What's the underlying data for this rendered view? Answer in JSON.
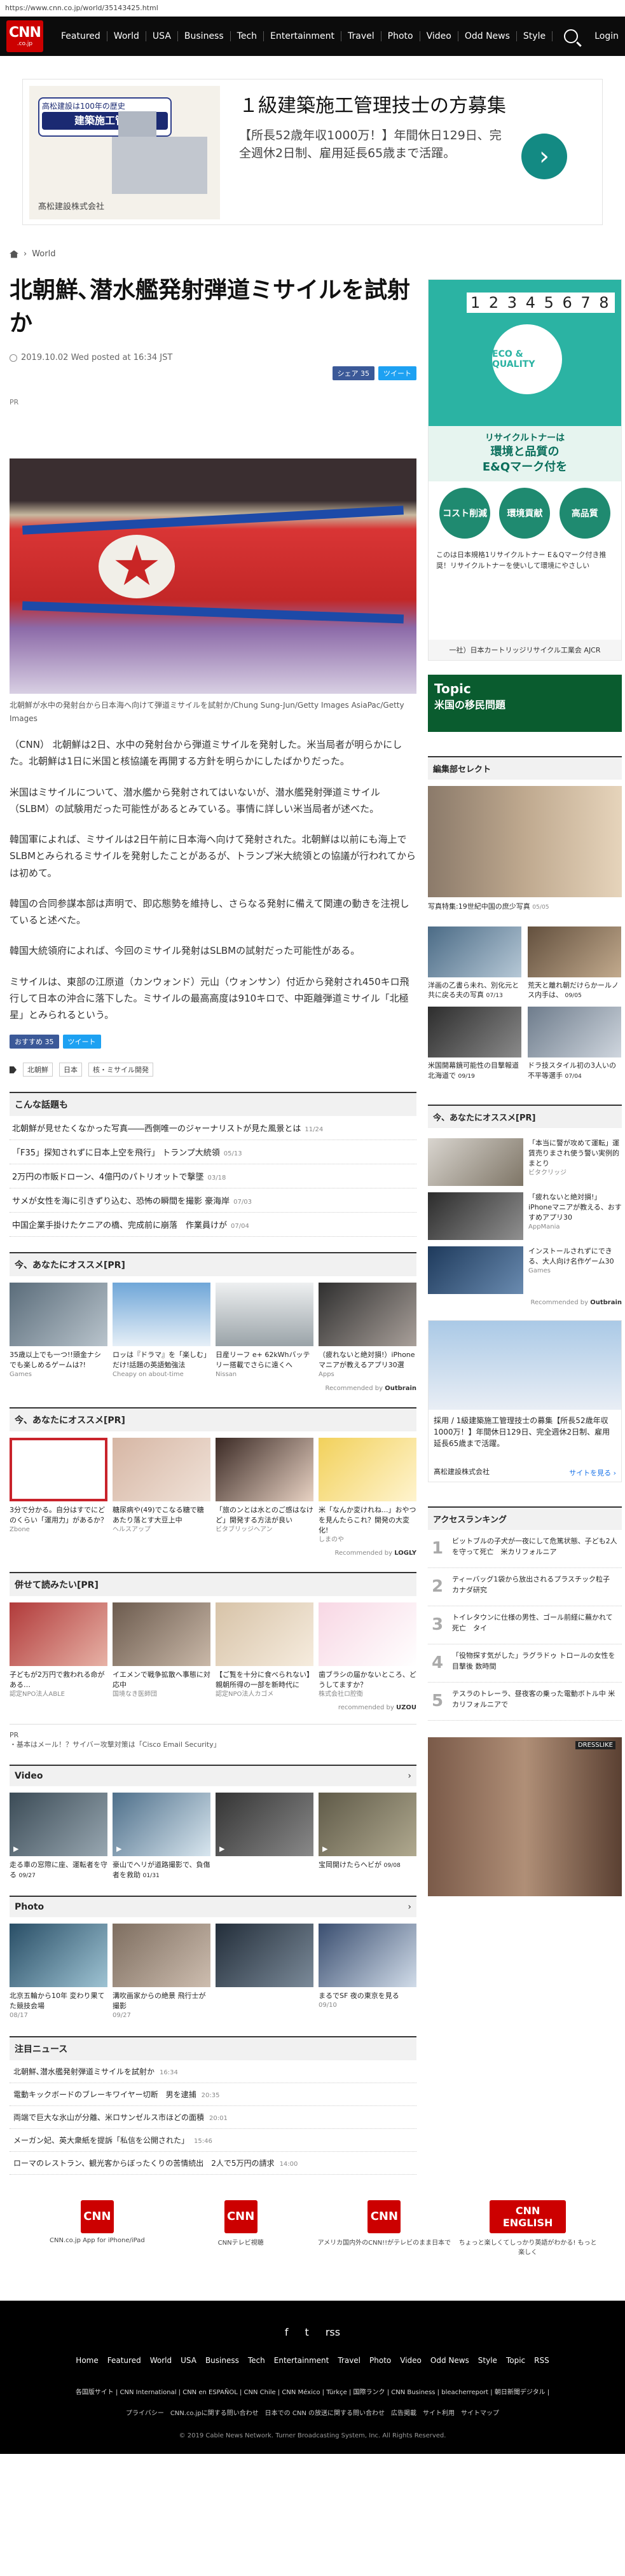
{
  "browser": {
    "url": "https://www.cnn.co.jp/world/35143425.html"
  },
  "nav": {
    "logo": "CNN",
    "logo_sub": ".co.jp",
    "links": [
      "Featured",
      "World",
      "USA",
      "Business",
      "Tech",
      "Entertainment",
      "Travel",
      "Photo",
      "Video",
      "Odd News",
      "Style"
    ],
    "login": "Login"
  },
  "ad_top": {
    "banner_line1": "高松建設は100年の歴史",
    "banner_title": "建築施工管理",
    "banner_company": "髙松建設株式会社",
    "headline": "１級建築施工管理技士の方募集",
    "body": "【所長52歳年収1000万！】年間休日129日、完全週休2日制、雇用延長65歳まで活躍。",
    "arrow": "›"
  },
  "breadcrumb": {
    "section": "World"
  },
  "article": {
    "title": "北朝鮮､潜水艦発射弾道ミサイルを試射か",
    "date": "2019.10.02 Wed posted at 16:34 JST",
    "share_fb": "シェア 35",
    "share_tw": "ツイート",
    "pr": "PR",
    "caption": "北朝鮮が水中の発射台から日本海へ向けて弾道ミサイルを試射か/Chung Sung-Jun/Getty Images AsiaPac/Getty Images",
    "paragraphs": [
      "（CNN） 北朝鮮は2日、水中の発射台から弾道ミサイルを発射した。米当局者が明らかにした。北朝鮮は1日に米国と核協議を再開する方針を明らかにしたばかりだった。",
      "米国はミサイルについて、潜水艦から発射されてはいないが、潜水艦発射弾道ミサイル（SLBM）の試験用だった可能性があるとみている。事情に詳しい米当局者が述べた。",
      "韓国軍によれば、ミサイルは2日午前に日本海へ向けて発射された。北朝鮮は以前にも海上でSLBMとみられるミサイルを発射したことがあるが、トランプ米大統領との協議が行われてからは初めて。",
      "韓国の合同参謀本部は声明で、即応態勢を維持し、さらなる発射に備えて関連の動きを注視していると述べた。",
      "韓国大統領府によれば、今回のミサイル発射はSLBMの試射だった可能性がある。",
      "ミサイルは、東部の江原道（カンウォンド）元山（ウォンサン）付近から発射され450キロ飛行して日本の沖合に落下した。ミサイルの最高高度は910キロで、中距離弾道ミサイル「北極星」とみられるという。"
    ],
    "share2_fb": "おすすめ 35",
    "share2_tw": "ツイート",
    "tags": [
      "北朝鮮",
      "日本",
      "核・ミサイル開発"
    ]
  },
  "related": {
    "heading": "こんな話題も",
    "items": [
      {
        "text": "北朝鮮が見せたくなかった写真――西側唯一のジャーナリストが見た風景とは",
        "date": "11/24"
      },
      {
        "text": "「F35」探知されずに日本上空を飛行」 トランプ大統領",
        "date": "05/13"
      },
      {
        "text": "2万円の市販ドローン、4億円のパトリオットで撃墜",
        "date": "03/18"
      },
      {
        "text": "サメが女性を海に引きずり込む、恐怖の瞬間を撮影 豪海岸",
        "date": "07/03"
      },
      {
        "text": "中国企業手掛けたケニアの橋、完成前に崩落　作業員けが",
        "date": "07/04"
      }
    ]
  },
  "recommend1": {
    "heading": "今、あなたにオススメ[PR]",
    "cards": [
      {
        "text": "35歳以上でも一つ!!頭金ナシでも楽しめるゲームは?!",
        "src": "Games"
      },
      {
        "text": "ロッは『ドラマ』を「楽しむ」だけ!話題の英語勉強法",
        "src": "Cheapy on about-time"
      },
      {
        "text": "日産リーフ e+ 62kWhバッテリー搭載でさらに遠くへ",
        "src": "Nissan"
      },
      {
        "text": "（疲れないと絶対損!）iPhoneマニアが教えるアプリ30選",
        "src": "Apps"
      }
    ],
    "footer": "Recommended by",
    "brand": "Outbrain"
  },
  "recommend2": {
    "heading": "今、あなたにオススメ[PR]",
    "cards": [
      {
        "text": "3分で分かる。自分はすでにどのくらい「運用力」があるか？",
        "src": "Zbone"
      },
      {
        "text": "糖尿病や(49)でこなる糖で糖あたり落とす大豆上中",
        "src": "ヘルスアップ"
      },
      {
        "text": "「旅のンとは水とのご感はなけど」開発する方法が良い",
        "src": "ビタブリッジヘアン"
      },
      {
        "text": "米「なんか変けれね...」おやつを見んたらこれ？開発の大変化!",
        "src": "しまのや"
      }
    ],
    "footer": "Recommended by",
    "brand": "LOGLY"
  },
  "recommend3": {
    "heading": "併せて読みたい[PR]",
    "cards": [
      {
        "text": "子どもが2万円で救われる命がある…",
        "src": "認定NPO法人ABLE"
      },
      {
        "text": "イエメンで戦争拡散へ事態に対応中",
        "src": "国境なき医師団"
      },
      {
        "text": "【ご覧を十分に食べられない】親朝所得の一部を新時代に",
        "src": "認定NPO法人カゴメ"
      },
      {
        "text": "歯ブラシの届かないところ、どうしてますか？",
        "src": "株式会社ロ腔衛"
      }
    ],
    "footer": "recommended by",
    "brand": "UZOU",
    "pr_line": "PR",
    "pr_text": "・基本はメール！？サイバー攻撃対策は「Cisco Email Security」"
  },
  "video": {
    "heading": "Video",
    "chevron": "›",
    "cards": [
      {
        "text": "走る車の窓際に座、運転者を守る",
        "date": "09/27"
      },
      {
        "text": "豪山でヘリが道路撮影で、負傷者を救助",
        "date": "01/31"
      },
      {
        "text": "",
        "date": ""
      },
      {
        "text": "宝岡開けたらヘビが",
        "date": "09/08"
      }
    ]
  },
  "photo": {
    "heading": "Photo",
    "chevron": "›",
    "cards": [
      {
        "text": "北京五輪から10年 変わり果てた競技会場",
        "date": "08/17"
      },
      {
        "text": "溝吹画家からの絶景 飛行士が撮影",
        "date": "09/27"
      },
      {
        "text": "",
        "date": ""
      },
      {
        "text": "まるでSF 夜の東京を見る",
        "date": "09/10"
      }
    ]
  },
  "news": {
    "heading": "注目ニュース",
    "items": [
      {
        "text": "北朝鮮､潜水艦発射弾道ミサイルを試射か",
        "date": "16:34"
      },
      {
        "text": "電動キックボードのブレーキワイヤー切断　男を逮捕",
        "date": "20:35"
      },
      {
        "text": "両端で巨大な氷山が分離、米ロサンゼルス市ほどの面積",
        "date": "20:01"
      },
      {
        "text": "メーガン妃、英大衆紙を提訴「私信を公開された」",
        "date": "15:46"
      },
      {
        "text": "ローマのレストラン、観光客からぼったくりの苦情続出　2人で5万円の請求",
        "date": "14:00"
      }
    ]
  },
  "apps": [
    {
      "label": "CNN.co.jp App for iPhone/iPad",
      "icon": "CNN"
    },
    {
      "label": "CNNテレビ視聴",
      "icon": "CNN"
    },
    {
      "label": "アメリカ国内外のCNN!!がテレビのまま日本で",
      "icon": "CNN"
    },
    {
      "label": "ちょっと楽しくてしっかり英語がわかる! もっと楽しく",
      "icon": "CNN ENGLISH"
    }
  ],
  "footer": {
    "social": [
      "f",
      "t",
      "rss"
    ],
    "nav": [
      "Home",
      "Featured",
      "World",
      "USA",
      "Business",
      "Tech",
      "Entertainment",
      "Travel",
      "Photo",
      "Video",
      "Odd News",
      "Style",
      "Topic",
      "RSS"
    ],
    "links1": "各国版サイト | CNN International | CNN en ESPAÑOL | CNN Chile | CNN México | Türkçe | 国際ランク | CNN Business | bleacherreport | 朝日新聞デジタル |",
    "links2": "プライバシー　CNN.co.jpに関する問い合わせ　日本での CNN の放送に関する問い合わせ　広告掲載　サイト利用　サイトマップ",
    "copyright": "© 2019 Cable News Network. Turner Broadcasting System, Inc. All Rights Reserved."
  },
  "side": {
    "ad1": {
      "number": "1 2 3 4 5 6 7 8",
      "badge": "ECO & QUALITY",
      "line1": "リサイクルトナーは",
      "line2": "環境と品質の",
      "line3": "E&Qマーク付を",
      "pills": [
        "コスト削減",
        "環境貢献",
        "高品質"
      ],
      "text": "このは日本規格1リサイクルトナー E＆Qマーク付き推奨！リサイクルトナーを使いして環境にやさしい",
      "bottom": "一社）日本カートリッジリサイクル工業会 AJCR"
    },
    "topic": {
      "title": "Topic",
      "sub": "米国の移民問題"
    },
    "editor_heading": "編集部セレクト",
    "photo_cap": "写真特集:19世紀中国の庶少写真",
    "photo_date": "05/05",
    "grid": [
      {
        "text": "洋画の乙書ら未れ、別化元と共に戻る夫の写真",
        "date": "07/13"
      },
      {
        "text": "荒天と離れ朝だけらかールノス内手は、",
        "date": "09/05"
      },
      {
        "text": "米国開幕鏡可能性の目撃報道 北海道で",
        "date": "09/19"
      },
      {
        "text": "ドラ技スタイル初の3人いの不平等選手",
        "date": "07/04"
      }
    ],
    "reco_heading": "今、あなたにオススメ[PR]",
    "reco": [
      {
        "text": "「本当に警が攻めて運転」運賃売りまされ使う警い実例的まとり",
        "src": "ビタクリッジ"
      },
      {
        "text": "「疲れないと絶対損!」iPhoneマニアが教える、おすすめアプリ30",
        "src": "AppMania"
      },
      {
        "text": "インストールされずにできる、大人向け名作ゲーム30",
        "src": "Games"
      }
    ],
    "reco_footer": "Recommended by",
    "reco_brand": "Outbrain",
    "ad2": {
      "text": "採用 / 1級建築施工管理技士の募集【所長52歳年収1000万！】年間休日129日、完全週休2日制、雇用延長65歳まで活躍。",
      "company": "髙松建設株式会社",
      "btn": "サイトを見る ›"
    },
    "ranking_heading": "アクセスランキング",
    "ranking": [
      "ビットブルの子犬が一夜にして危篤状態、子ども2人を守って死亡　米カリフォルニア",
      "ティーバッグ1袋から放出されるプラスチック粒子　カナダ研究",
      "トイレタウンに仕様の男性、ゴール前経に蕪かれて死亡　タイ",
      "「役物探す気がした」ラグラドゥ トロールの女性を目撃後 数時間",
      "テスラのトレーラ、昼夜客の乗った電動ボトル中 米カリフォルニアで"
    ],
    "ad3_label": "DRESSLIKE"
  }
}
